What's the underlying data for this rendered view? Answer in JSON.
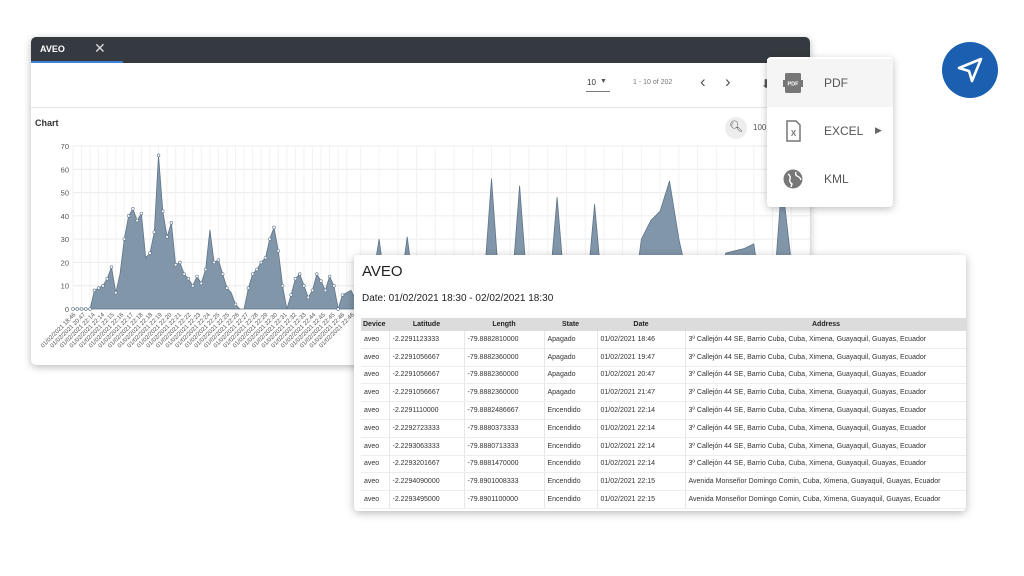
{
  "window": {
    "tab_title": "AVEO",
    "close_glyph": "✕",
    "toolbar": {
      "page_size": "10",
      "range_label": "1 - 10 of 202",
      "prev_glyph": "‹",
      "next_glyph": "›"
    },
    "chart_title": "Chart",
    "zoom_label": "100"
  },
  "export_menu": {
    "items": [
      {
        "label": "PDF",
        "icon": "pdf-file-icon"
      },
      {
        "label": "EXCEL",
        "icon": "excel-file-icon",
        "has_submenu": true
      },
      {
        "label": "KML",
        "icon": "globe-icon"
      }
    ]
  },
  "report": {
    "title": "AVEO",
    "date_range": "Date: 01/02/2021 18:30 - 02/02/2021 18:30",
    "columns": [
      "Device",
      "Latitude",
      "Length",
      "State",
      "Date",
      "Address"
    ],
    "rows": [
      [
        "aveo",
        "-2.2291123333",
        "-79.8882810000",
        "Apagado",
        "01/02/2021 18:46",
        "3º Callejón 44 SE, Barrio Cuba, Cuba, Ximena, Guayaquil, Guayas, Ecuador"
      ],
      [
        "aveo",
        "-2.2291056667",
        "-79.8882360000",
        "Apagado",
        "01/02/2021 19:47",
        "3º Callejón 44 SE, Barrio Cuba, Cuba, Ximena, Guayaquil, Guayas, Ecuador"
      ],
      [
        "aveo",
        "-2.2291056667",
        "-79.8882360000",
        "Apagado",
        "01/02/2021 20:47",
        "3º Callejón 44 SE, Barrio Cuba, Cuba, Ximena, Guayaquil, Guayas, Ecuador"
      ],
      [
        "aveo",
        "-2.2291056667",
        "-79.8882360000",
        "Apagado",
        "01/02/2021 21:47",
        "3º Callejón 44 SE, Barrio Cuba, Cuba, Ximena, Guayaquil, Guayas, Ecuador"
      ],
      [
        "aveo",
        "-2.2291110000",
        "-79.8882486667",
        "Encendido",
        "01/02/2021 22:14",
        "3º Callejón 44 SE, Barrio Cuba, Cuba, Ximena, Guayaquil, Guayas, Ecuador"
      ],
      [
        "aveo",
        "-2.2292723333",
        "-79.8880373333",
        "Encendido",
        "01/02/2021 22:14",
        "3º Callejón 44 SE, Barrio Cuba, Cuba, Ximena, Guayaquil, Guayas, Ecuador"
      ],
      [
        "aveo",
        "-2.2293063333",
        "-79.8880713333",
        "Encendido",
        "01/02/2021 22:14",
        "3º Callejón 44 SE, Barrio Cuba, Cuba, Ximena, Guayaquil, Guayas, Ecuador"
      ],
      [
        "aveo",
        "-2.2293201667",
        "-79.8881470000",
        "Encendido",
        "01/02/2021 22:14",
        "3º Callejón 44 SE, Barrio Cuba, Cuba, Ximena, Guayaquil, Guayas, Ecuador"
      ],
      [
        "aveo",
        "-2.2294090000",
        "-79.8901008333",
        "Encendido",
        "01/02/2021 22:15",
        "Avenida Monseñor Domingo Comin, Cuba, Ximena, Guayaquil, Guayas, Ecuador"
      ],
      [
        "aveo",
        "-2.2293495000",
        "-79.8901100000",
        "Encendido",
        "01/02/2021 22:15",
        "Avenida Monseñor Domingo Comin, Cuba, Ximena, Guayaquil, Guayas, Ecuador"
      ]
    ]
  },
  "colors": {
    "titlebar": "#353a40",
    "tab_underline": "#3f7fd6",
    "area_fill": "#8196a9",
    "area_stroke": "#5f7489",
    "point": "#ffffff",
    "nav_bubble": "#1a5fb0"
  },
  "chart_data": {
    "type": "area",
    "title": "Chart",
    "xlabel": "",
    "ylabel": "",
    "ylim": [
      0,
      70
    ],
    "yticks": [
      0,
      10,
      20,
      30,
      40,
      50,
      60,
      70
    ],
    "grid": true,
    "x_tick_labels": [
      "01/02/2021 18:46",
      "01/02/2021 20:47",
      "01/02/2021 22:14",
      "01/02/2021 22:14",
      "01/02/2021 22:15",
      "01/02/2021 22:16",
      "01/02/2021 22:17",
      "01/02/2021 22:18",
      "01/02/2021 22:18",
      "01/02/2021 22:19",
      "01/02/2021 22:20",
      "01/02/2021 22:21",
      "01/02/2021 22:22",
      "01/02/2021 22:23",
      "01/02/2021 22:24",
      "01/02/2021 22:25",
      "01/02/2021 22:25",
      "01/02/2021 22:26",
      "01/02/2021 22:27",
      "01/02/2021 22:28",
      "01/02/2021 22:29",
      "01/02/2021 22:30",
      "01/02/2021 22:31",
      "01/02/2021 22:32",
      "01/02/2021 22:33",
      "01/02/2021 22:44",
      "01/02/2021 22:45",
      "01/02/2021 22:45",
      "01/02/2021 22:46",
      "01/02/2021 22:46"
    ],
    "values": [
      0,
      0,
      0,
      0,
      0,
      8,
      9,
      10,
      13,
      18,
      7,
      15,
      30,
      40,
      43,
      38,
      41,
      22,
      24,
      33,
      66,
      42,
      31,
      37,
      19,
      20,
      15,
      13,
      10,
      14,
      11,
      17,
      34,
      20,
      21,
      15,
      9,
      7,
      2,
      0,
      0,
      9,
      15,
      17,
      20,
      22,
      30,
      35,
      25,
      10,
      0,
      6,
      13,
      15,
      10,
      5,
      8,
      15,
      12,
      8,
      14,
      10,
      0,
      6,
      7,
      8
    ],
    "tail_values": [
      0,
      5,
      30,
      0,
      0,
      31,
      0,
      0,
      0,
      0,
      0,
      0,
      0,
      0,
      56,
      0,
      0,
      53,
      0,
      0,
      0,
      48,
      0,
      0,
      0,
      45,
      0,
      0,
      0,
      0,
      30,
      38,
      42,
      55,
      30,
      12,
      0,
      0,
      0,
      24,
      25,
      26,
      28,
      0,
      0,
      55,
      20,
      0,
      0
    ],
    "point_indices": [
      0,
      1,
      2,
      3,
      4,
      5,
      6,
      7,
      8,
      9,
      10,
      12,
      13,
      14,
      15,
      16,
      18,
      19,
      20,
      21,
      22,
      23,
      24,
      25,
      26,
      27,
      28,
      29,
      30,
      31,
      33,
      34,
      35,
      36,
      38,
      41,
      42,
      43,
      44,
      45,
      46,
      47,
      48,
      49,
      51,
      52,
      53,
      54,
      55,
      56,
      57,
      58,
      59,
      60,
      61,
      62,
      63
    ]
  }
}
